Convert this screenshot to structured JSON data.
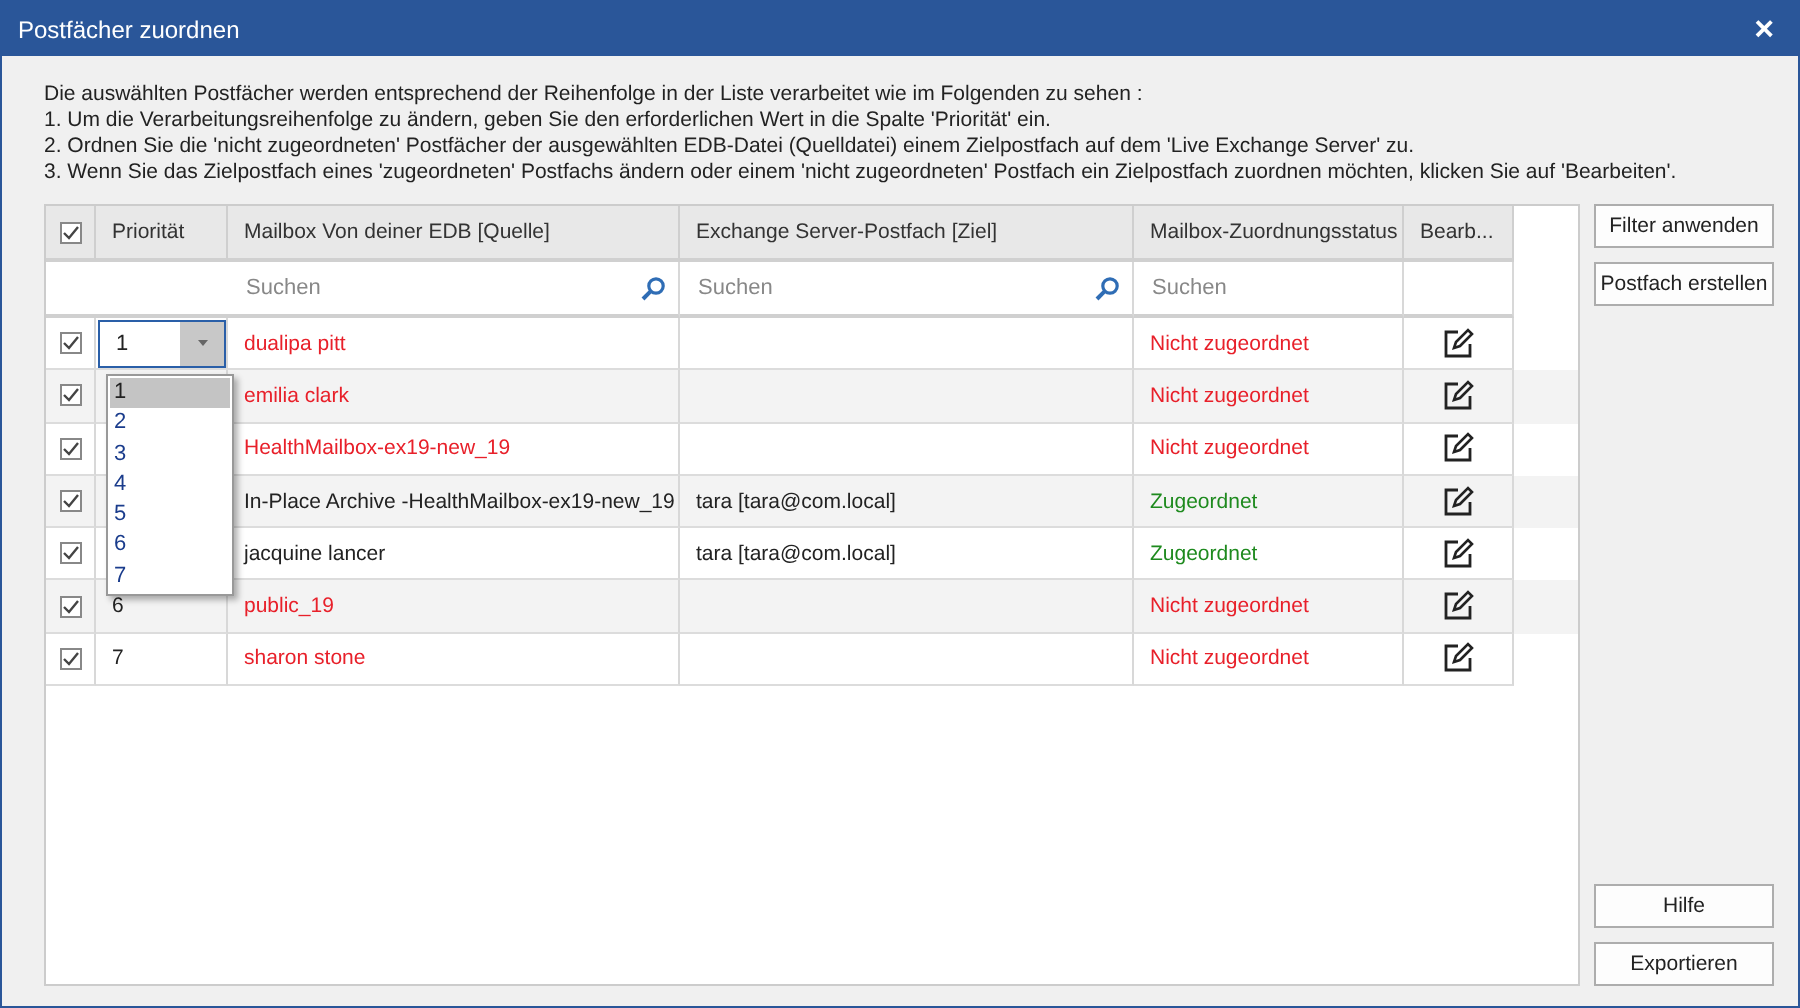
{
  "window": {
    "title": "Postfächer zuordnen",
    "close": "×"
  },
  "instructions": [
    "Die auswählten Postfächer werden entsprechend der Reihenfolge in der Liste verarbeitet wie im Folgenden zu sehen :",
    "1. Um die Verarbeitungsreihenfolge zu ändern, geben Sie den erforderlichen Wert in die Spalte 'Priorität' ein.",
    "2. Ordnen Sie die 'nicht zugeordneten' Postfächer der ausgewählten EDB-Datei (Quelldatei) einem Zielpostfach auf dem 'Live Exchange Server' zu.",
    "3. Wenn Sie das Zielpostfach eines 'zugeordneten' Postfachs ändern oder einem 'nicht zugeordneten' Postfach ein Zielpostfach zuordnen möchten, klicken Sie auf 'Bearbeiten'."
  ],
  "table": {
    "select_all_checked": true,
    "columns": [
      "Priorität",
      "Mailbox Von deiner EDB [Quelle]",
      "Exchange Server-Postfach [Ziel]",
      "Mailbox-Zuordnungsstatus",
      "Bearb..."
    ],
    "search_placeholders": [
      "Suchen",
      "Suchen",
      "Suchen"
    ],
    "rows": [
      {
        "checked": true,
        "priority": "1",
        "dropdown_open": true,
        "source": "dualipa pitt",
        "target": "",
        "status": "Nicht zugeordnet",
        "mapped": false
      },
      {
        "checked": true,
        "source": "emilia clark",
        "target": "",
        "status": "Nicht zugeordnet",
        "mapped": false
      },
      {
        "checked": true,
        "source": "HealthMailbox-ex19-new_19",
        "target": "",
        "status": "Nicht zugeordnet",
        "mapped": false
      },
      {
        "checked": true,
        "source": "In-Place Archive -HealthMailbox-ex19-new_19",
        "target": "tara [tara@com.local]",
        "status": "Zugeordnet",
        "mapped": true
      },
      {
        "checked": true,
        "source": "jacquine lancer",
        "target": "tara [tara@com.local]",
        "status": "Zugeordnet",
        "mapped": true
      },
      {
        "checked": true,
        "priority": "6",
        "source": "public_19",
        "target": "",
        "status": "Nicht zugeordnet",
        "mapped": false
      },
      {
        "checked": true,
        "priority": "7",
        "source": "sharon stone",
        "target": "",
        "status": "Nicht zugeordnet",
        "mapped": false
      }
    ],
    "priority_dropdown": {
      "options": [
        {
          "label": "1",
          "selected": true
        },
        {
          "label": "2",
          "selected": false
        },
        {
          "label": "3",
          "selected": false
        },
        {
          "label": "4",
          "selected": false
        },
        {
          "label": "5",
          "selected": false
        },
        {
          "label": "6",
          "selected": false
        },
        {
          "label": "7",
          "selected": false
        }
      ]
    }
  },
  "side_buttons_top": [
    "Filter anwenden",
    "Postfach erstellen"
  ],
  "side_buttons_bottom": [
    "Hilfe",
    "Exportieren"
  ]
}
